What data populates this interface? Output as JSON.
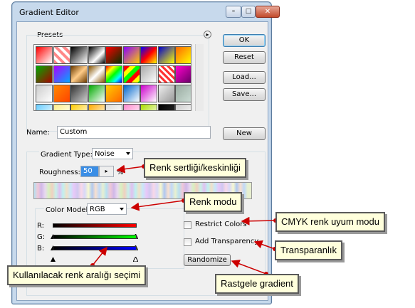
{
  "window": {
    "title": "Gradient Editor",
    "min_glyph": "–",
    "max_glyph": "□",
    "close_glyph": "✕"
  },
  "presets": {
    "label": "Presets",
    "menu_glyph": "▸",
    "swatches": [
      "linear-gradient(135deg,#ff0000,#fff)",
      "repeating-linear-gradient(45deg,#ff8888 0 4px,#fff 4px 8px)",
      "linear-gradient(135deg,#000,#fff)",
      "linear-gradient(135deg,#000,#fff 60%,#000)",
      "linear-gradient(135deg,#ff0000,#003300)",
      "linear-gradient(135deg,#8800ff,#ffcc00)",
      "linear-gradient(135deg,#0000ff,#ff0000,#ffff00)",
      "linear-gradient(135deg,#0000cc,#ffff00)",
      "linear-gradient(135deg,#ff6600,#ffff00)",
      "linear-gradient(135deg,#00aa00,#aa0000)",
      "linear-gradient(135deg,#aa00ff,#00aaff)",
      "linear-gradient(135deg,#6b3a00,#ffcc88,#6b3a00)",
      "linear-gradient(135deg,#885500,#fff,#885500)",
      "linear-gradient(135deg,#ff0000,#ffff00,#00ff00,#00ffff,#0000ff)",
      "repeating-linear-gradient(135deg,#ff0000 0 6px,#ffff00 6px 12px,#00ff00 12px 18px)",
      "linear-gradient(135deg,#aaaaaa,#fff)",
      "repeating-linear-gradient(45deg,#ff3333 0 3px,#fff 3px 6px)",
      "linear-gradient(135deg,#ff00cc,#660066)",
      "linear-gradient(135deg,#ccc,#fff)",
      "linear-gradient(135deg,#ff8800,#ff4400)",
      "linear-gradient(135deg,#333,#ccc)",
      "linear-gradient(135deg,#00aa00,#fff)",
      "linear-gradient(135deg,#ffcc00,#ff6600)",
      "linear-gradient(135deg,#0066cc,#fff)",
      "linear-gradient(135deg,#cc00cc,#fff)",
      "linear-gradient(135deg,#eee,#999)",
      "linear-gradient(135deg,#99aaa0,#ccddd5)",
      "linear-gradient(135deg,#66ccff,#fff)",
      "linear-gradient(135deg,#ffee88,#fff)",
      "linear-gradient(135deg,#ffcc00,#fff)",
      "linear-gradient(135deg,#ffaa00,#fff)",
      "linear-gradient(135deg,#dddddd,#fff)",
      "linear-gradient(135deg,#ff88cc,#fff)",
      "linear-gradient(135deg,#aadd00,#fff)",
      "linear-gradient(135deg,#000,#333)",
      "linear-gradient(135deg,#cccccc,#fff)"
    ]
  },
  "buttons": {
    "ok": "OK",
    "reset": "Reset",
    "load": "Load...",
    "save": "Save...",
    "new": "New",
    "randomize": "Randomize"
  },
  "name": {
    "label": "Name:",
    "value": "Custom"
  },
  "gradient_type": {
    "label": "Gradient Type:",
    "value": "Noise"
  },
  "roughness": {
    "label": "Roughness:",
    "value": "50",
    "unit": "%"
  },
  "color_model": {
    "label": "Color Model:",
    "value": "RGB",
    "channels": [
      {
        "label": "R:",
        "from": "#000000",
        "to": "#ff0000"
      },
      {
        "label": "G:",
        "from": "#000000",
        "to": "#00ff00"
      },
      {
        "label": "B:",
        "from": "#000000",
        "to": "#0000ff"
      }
    ]
  },
  "options": {
    "restrict_colors": "Restrict Colors",
    "add_transparency": "Add Transparency"
  },
  "callouts": {
    "roughness": "Renk sertliği/keskinliği",
    "color_model": "Renk modu",
    "cmyk": "CMYK renk uyum modu",
    "transparency": "Transparanlık",
    "randomize": "Rastgele gradient",
    "range": "Kullanılacak renk aralığı seçimi"
  },
  "colors": {
    "arrow": "#cc0000",
    "callout_bg": "#ffffdc",
    "window_frame": "#c7d9ec"
  }
}
